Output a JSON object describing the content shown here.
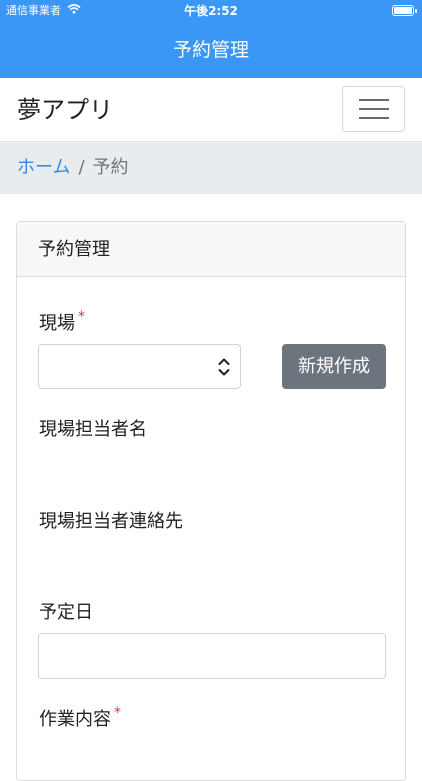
{
  "status_bar": {
    "carrier": "通信事業者",
    "time": "午後2:52"
  },
  "header": {
    "title": "予約管理"
  },
  "navbar": {
    "brand": "夢アプリ"
  },
  "breadcrumb": {
    "home": "ホーム",
    "separator": "/",
    "current": "予約"
  },
  "card": {
    "title": "予約管理",
    "fields": {
      "site_label": "現場",
      "site_required": "*",
      "site_value": "",
      "new_button": "新規作成",
      "site_contact_name_label": "現場担当者名",
      "site_contact_phone_label": "現場担当者連絡先",
      "scheduled_date_label": "予定日",
      "scheduled_date_value": "",
      "work_content_label": "作業内容",
      "work_content_required": "*"
    }
  }
}
